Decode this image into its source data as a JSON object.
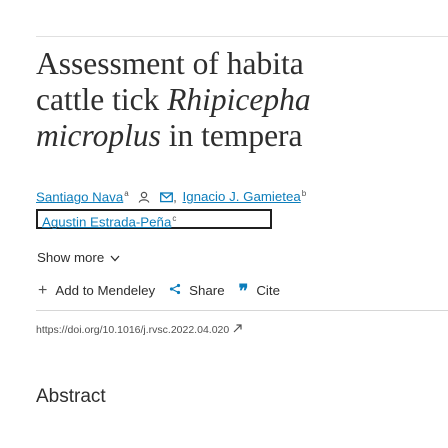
{
  "article": {
    "title_lines": [
      "Assessment of habita",
      "cattle tick ",
      "Rhipicepha",
      "microplus",
      " in tempera"
    ]
  },
  "authors": [
    {
      "name": "Santiago Nava",
      "sup": "a"
    },
    {
      "name": "Ignacio J. Gamietea",
      "sup": "b"
    },
    {
      "name": "Agustin Estrada-Peña",
      "sup": "c"
    }
  ],
  "icons": {
    "person": "person-icon",
    "email": "envelope-icon",
    "chevron": "chevron-down-icon",
    "add": "plus-icon",
    "share": "share-icon",
    "cite": "quote-icon",
    "external": "external-link-icon"
  },
  "show_more": {
    "label": "Show more"
  },
  "actions": {
    "add_mendeley": "Add to Mendeley",
    "share": "Share",
    "cite": "Cite"
  },
  "doi": {
    "url": "https://doi.org/10.1016/j.rvsc.2022.04.020"
  },
  "abstract": {
    "heading": "Abstract"
  }
}
